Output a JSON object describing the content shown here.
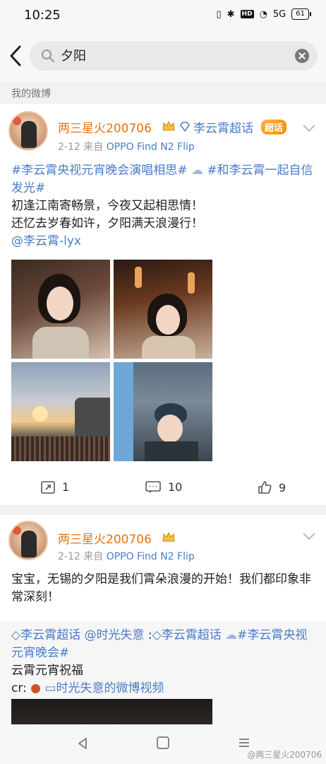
{
  "status": {
    "time": "10:25",
    "network": "5G",
    "battery": "61"
  },
  "search": {
    "query": "夕阳"
  },
  "section_label": "我的微博",
  "posts": [
    {
      "username": "两三星火200706",
      "super_topic": "李云霄超话",
      "badge": "超话",
      "date": "2-12",
      "source_prefix": "来自",
      "device": "OPPO Find N2 Flip",
      "text_topic1": "#李云霄央视元宵晚会演唱相思#",
      "text_topic2": "#和李云霄一起自信发光#",
      "line1": "初逢江南寄畅景，今夜又起相思情！",
      "line2": "还忆去岁春如许，夕阳满天浪漫行！",
      "mention": "@李云霄-lyx",
      "reposts": "1",
      "comments": "10",
      "likes": "9"
    },
    {
      "username": "两三星火200706",
      "date": "2-12",
      "source_prefix": "来自",
      "device": "OPPO Find N2 Flip",
      "text": "宝宝，无锡的夕阳是我们霄朵浪漫的开始！我们都印象非常深刻！",
      "repost_topic": "李云霄超话",
      "repost_user": "@时光失意",
      "repost_user_topic": "李云霄超话",
      "repost_hashtag": "#李云霄央视元宵晚会#",
      "repost_line": "云霄元宵祝福",
      "repost_cr": "cr:",
      "repost_video": "时光失意的微博视频"
    }
  ],
  "watermark": "@两三星火200706",
  "colors": {
    "accent": "#e8730f",
    "link": "#4a7cc8"
  }
}
